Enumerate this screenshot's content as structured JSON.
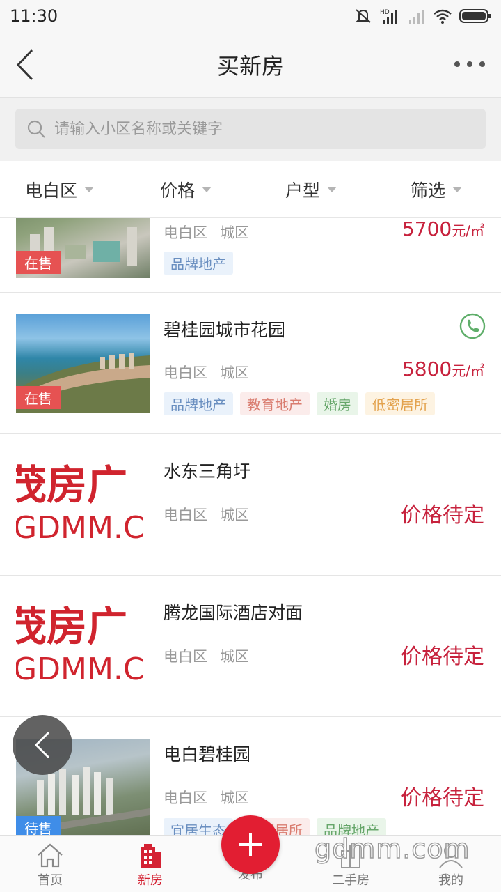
{
  "status_bar": {
    "time": "11:30",
    "network_label": "HD"
  },
  "header": {
    "title": "买新房"
  },
  "search": {
    "placeholder": "请输入小区名称或关键字"
  },
  "filters": [
    "电白区",
    "价格",
    "户型",
    "筛选"
  ],
  "listings": [
    {
      "name": "",
      "district": "电白区",
      "area": "城区",
      "price_num": "5700",
      "price_unit": "元/㎡",
      "status": "在售",
      "tags": [
        {
          "label": "品牌地产",
          "color": "blue"
        }
      ]
    },
    {
      "name": "碧桂园城市花园",
      "district": "电白区",
      "area": "城区",
      "price_num": "5800",
      "price_unit": "元/㎡",
      "status": "在售",
      "tags": [
        {
          "label": "品牌地产",
          "color": "blue"
        },
        {
          "label": "教育地产",
          "color": "red"
        },
        {
          "label": "婚房",
          "color": "green"
        },
        {
          "label": "低密居所",
          "color": "orange"
        }
      ]
    },
    {
      "name": "水东三角圩",
      "district": "电白区",
      "area": "城区",
      "price_text": "价格待定",
      "logo_text_top": "茂房广",
      "logo_text_bottom": "GDMM.C"
    },
    {
      "name": "腾龙国际酒店对面",
      "district": "电白区",
      "area": "城区",
      "price_text": "价格待定",
      "logo_text_top": "茂房广",
      "logo_text_bottom": "GDMM.C"
    },
    {
      "name": "电白碧桂园",
      "district": "电白区",
      "area": "城区",
      "price_text": "价格待定",
      "status": "待售",
      "tags": [
        {
          "label": "宜居生态",
          "color": "blue"
        },
        {
          "label": "景观居所",
          "color": "red"
        },
        {
          "label": "品牌地产",
          "color": "green"
        }
      ]
    }
  ],
  "tabbar": {
    "home": "首页",
    "new_house": "新房",
    "publish": "发布",
    "second_hand": "二手房",
    "mine": "我的"
  },
  "watermark": "gdmm.com",
  "colors": {
    "accent": "#d42233",
    "price": "#c7223d",
    "sale_badge": "#e65252",
    "presale_badge": "#3f8de8"
  }
}
